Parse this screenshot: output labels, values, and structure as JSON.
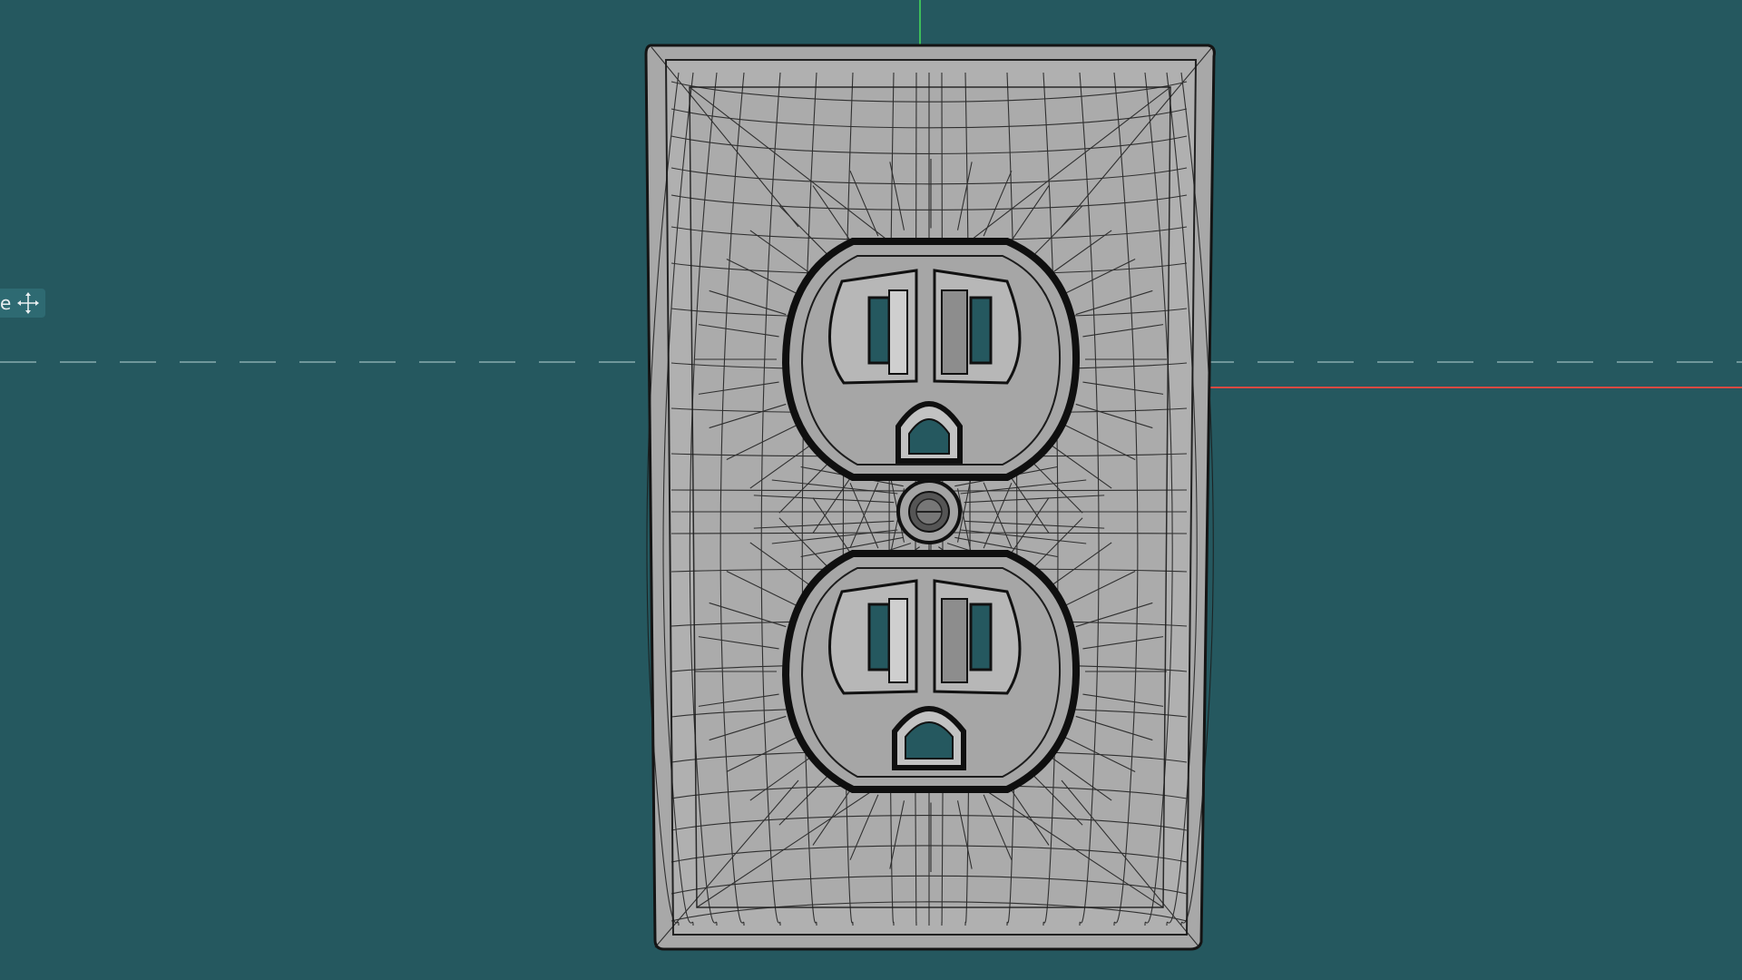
{
  "viewport": {
    "background_color": "#25585f",
    "view_label": "e",
    "view_label_icon": "move-icon"
  },
  "axes": {
    "y_axis_color": "#3dbd5a",
    "x_axis_color": "#d84a42",
    "horizon_color": "#7a9ea2"
  },
  "model": {
    "object": "duplex-outlet-wall-plate",
    "display_mode": "wireframe-on-shaded",
    "plate_color": "#a9a9a9",
    "wire_color": "#161616",
    "slot_color": "#25585f",
    "outlets": 2,
    "screws": 1
  }
}
